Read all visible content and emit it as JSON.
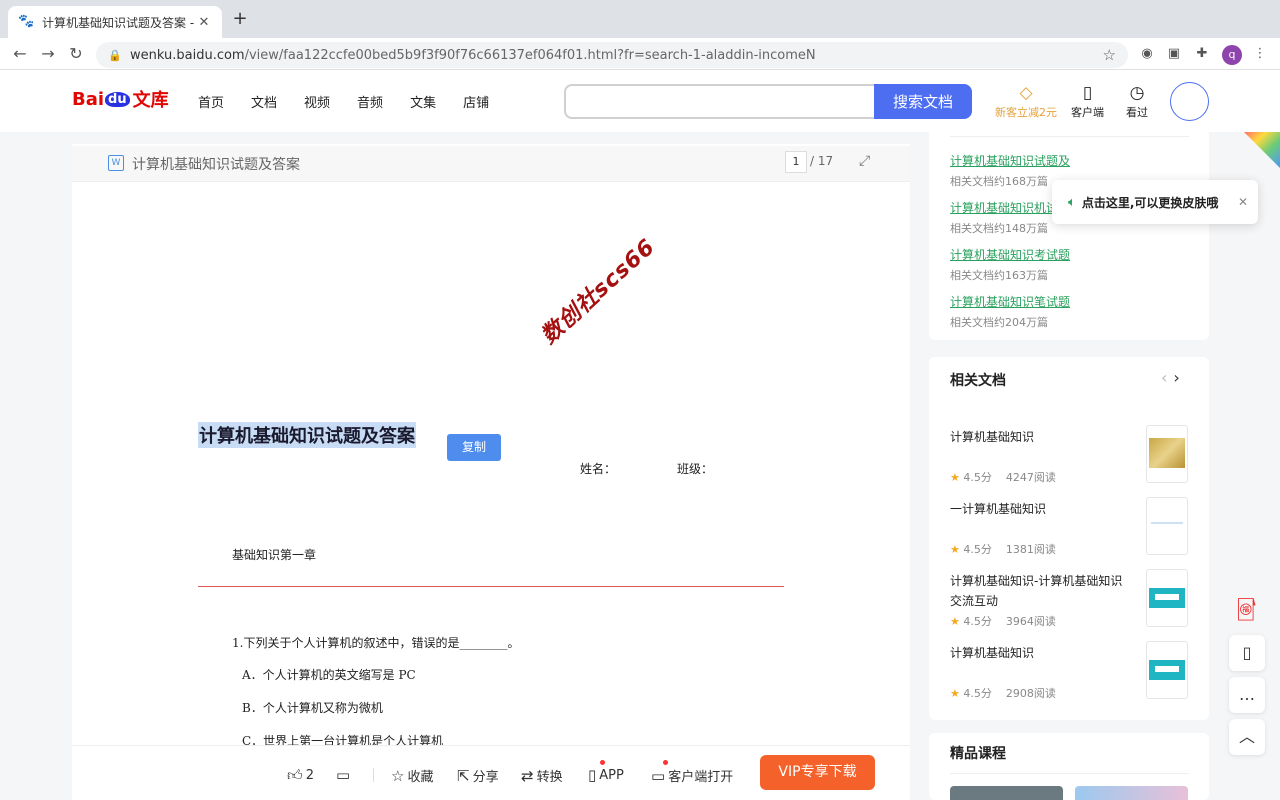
{
  "browser": {
    "tab_title": "计算机基础知识试题及答案 - 百",
    "url_main": "wenku.baidu.com",
    "url_path": "/view/faa122ccfe00bed5b9f3f90f76c66137ef064f01.html?fr=search-1-aladdin-incomeN",
    "profile_initial": "q"
  },
  "header": {
    "logo_bai": "Bai",
    "logo_du": "du",
    "logo_wk": "文库",
    "nav": [
      "首页",
      "文档",
      "视频",
      "音频",
      "文集",
      "店铺"
    ],
    "search_placeholder": "",
    "search_button": "搜索文档",
    "promo_label": "新客立减2元",
    "client_label": "客户端",
    "history_label": "看过"
  },
  "document": {
    "title": "计算机基础知识试题及答案",
    "current_page": "1",
    "total_pages": "/ 17",
    "watermark": "数创社scs66",
    "heading": "计算机基础知识试题及答案",
    "copy_button": "复制",
    "name_label": "姓名：",
    "class_label": "班级：",
    "chapter": "基础知识第一章",
    "question1": "1.下列关于个人计算机的叙述中，错误的是________。",
    "options": [
      "A．个人计算机的英文缩写是 PC",
      "B．个人计算机又称为微机",
      "C．世界上第一台计算机是个人计算机"
    ]
  },
  "actions": {
    "like_count": "2",
    "collect": "收藏",
    "share": "分享",
    "convert": "转换",
    "app": "APP",
    "client_open": "客户端打开",
    "vip_download": "VIP专享下载"
  },
  "sidebar": {
    "suggestions": [
      {
        "title": "计算机基础知识试题及",
        "meta": "相关文档约168万篇"
      },
      {
        "title": "计算机基础知识机试",
        "meta": "相关文档约148万篇"
      },
      {
        "title": "计算机基础知识考试题",
        "meta": "相关文档约163万篇"
      },
      {
        "title": "计算机基础知识笔试题",
        "meta": "相关文档约204万篇"
      }
    ],
    "tooltip": "点击这里,可以更换皮肤哦",
    "related_header": "相关文档",
    "related": [
      {
        "title": "计算机基础知识",
        "rating": "4.5分",
        "reads": "4247阅读"
      },
      {
        "title": "一计算机基础知识",
        "rating": "4.5分",
        "reads": "1381阅读"
      },
      {
        "title": "计算机基础知识-计算机基础知识交流互动",
        "rating": "4.5分",
        "reads": "3964阅读"
      },
      {
        "title": "计算机基础知识",
        "rating": "4.5分",
        "reads": "2908阅读"
      }
    ],
    "courses_header": "精品课程"
  }
}
